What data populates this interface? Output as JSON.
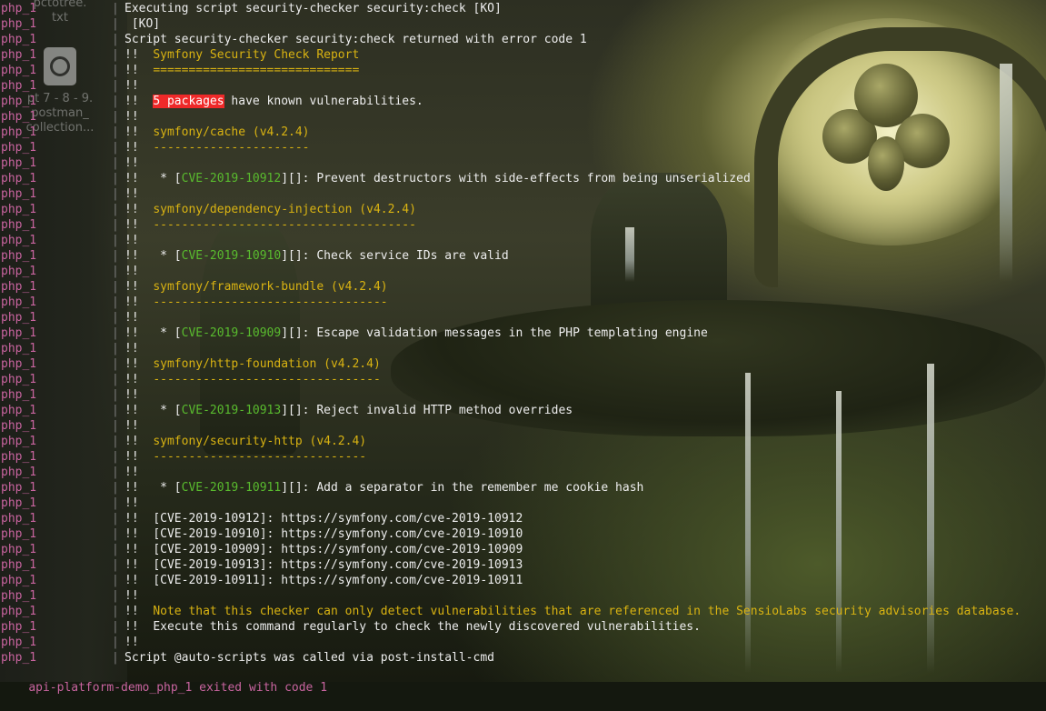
{
  "prefix": "php_1",
  "separator": "|",
  "desktop": {
    "file1_label_a": "pctotree.",
    "file1_label_b": "txt",
    "file2_label_a": "pt 7 - 8 - 9.",
    "file2_label_b": "postman_",
    "file2_label_c": "collection..."
  },
  "lines": {
    "l1": "Executing script security-checker security:check [KO]",
    "l2": " [KO]",
    "l3": "Script security-checker security:check returned with error code 1",
    "bang": "!!",
    "report_title": "Symfony Security Check Report",
    "report_rule": "=============================",
    "pkg_count": "5 packages",
    "pkg_count_rest": " have known vulnerabilities.",
    "p1_name": "symfony/cache (v4.2.4)",
    "p1_rule": "----------------------",
    "p1_cve": "CVE-2019-10912",
    "p1_desc": "[]: Prevent destructors with side-effects from being unserialized",
    "p2_name": "symfony/dependency-injection (v4.2.4)",
    "p2_rule": "-------------------------------------",
    "p2_cve": "CVE-2019-10910",
    "p2_desc": "[]: Check service IDs are valid",
    "p3_name": "symfony/framework-bundle (v4.2.4)",
    "p3_rule": "---------------------------------",
    "p3_cve": "CVE-2019-10909",
    "p3_desc": "[]: Escape validation messages in the PHP templating engine",
    "p4_name": "symfony/http-foundation (v4.2.4)",
    "p4_rule": "--------------------------------",
    "p4_cve": "CVE-2019-10913",
    "p4_desc": "[]: Reject invalid HTTP method overrides",
    "p5_name": "symfony/security-http (v4.2.4)",
    "p5_rule": "------------------------------",
    "p5_cve": "CVE-2019-10911",
    "p5_desc": "[]: Add a separator in the remember me cookie hash",
    "bullet_open": " * [",
    "bullet_close": "]",
    "ref1": "[CVE-2019-10912]: https://symfony.com/cve-2019-10912",
    "ref2": "[CVE-2019-10910]: https://symfony.com/cve-2019-10910",
    "ref3": "[CVE-2019-10909]: https://symfony.com/cve-2019-10909",
    "ref4": "[CVE-2019-10913]: https://symfony.com/cve-2019-10913",
    "ref5": "[CVE-2019-10911]: https://symfony.com/cve-2019-10911",
    "note": "Note that this checker can only detect vulnerabilities that are referenced in the SensioLabs security advisories database.",
    "execute": "Execute this command regularly to check the newly discovered vulnerabilities.",
    "auto_scripts": "Script @auto-scripts was called via post-install-cmd",
    "exit": "api-platform-demo_php_1 exited with code 1"
  },
  "colors": {
    "prefix": "#c8649f",
    "text": "#ededed",
    "yellow": "#d9b312",
    "green": "#59bb2e",
    "highlight": "#ef2929"
  }
}
